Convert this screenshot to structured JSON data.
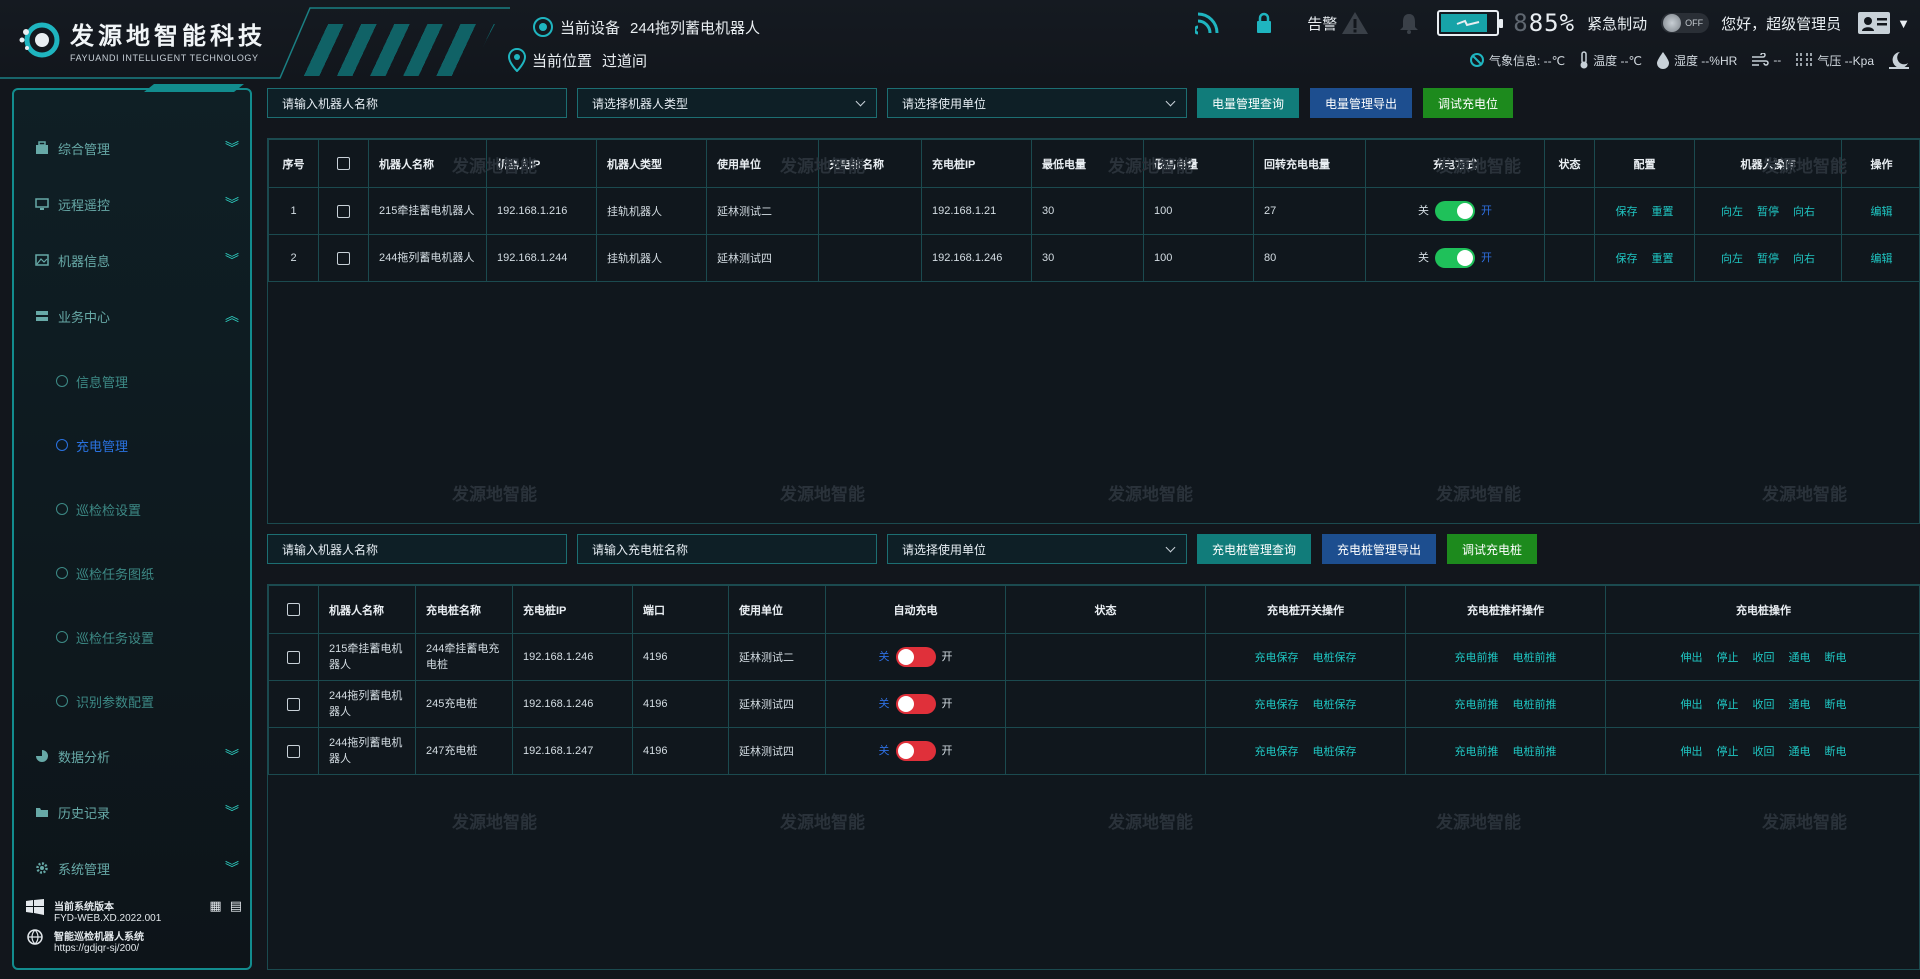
{
  "header": {
    "logo_cn": "发源地智能科技",
    "logo_en": "FAYUANDI INTELLIGENT TECHNOLOGY",
    "current_device_label": "当前设备",
    "current_device_value": "244拖列蓄电机器人",
    "current_position_label": "当前位置",
    "current_position_value": "过道间",
    "alarm_label": "告警",
    "battery_percent_digits": "85",
    "battery_percent_dim": "8",
    "percent_sign": "%",
    "battery_level": 0.85,
    "emergency_label": "紧急制动",
    "toggle_label": "OFF",
    "greeting": "您好，",
    "user_role": "超级管理员",
    "weather": {
      "weather_label": "气象信息: --℃",
      "temp_label": "温度 --℃",
      "humidity_label": "湿度 --%HR",
      "wind_label": "--",
      "pressure_label": "气压 --Kpa"
    }
  },
  "sidebar": {
    "items": [
      {
        "label": "综合管理",
        "expanded": false
      },
      {
        "label": "远程遥控",
        "expanded": false
      },
      {
        "label": "机器信息",
        "expanded": false
      },
      {
        "label": "业务中心",
        "expanded": true
      },
      {
        "label": "数据分析",
        "expanded": false
      },
      {
        "label": "历史记录",
        "expanded": false
      },
      {
        "label": "系统管理",
        "expanded": false
      }
    ],
    "sub_items": [
      {
        "label": "信息管理"
      },
      {
        "label": "充电管理"
      },
      {
        "label": "巡检检设置"
      },
      {
        "label": "巡检任务图纸"
      },
      {
        "label": "巡检任务设置"
      },
      {
        "label": "识别参数配置"
      }
    ],
    "version_label": "当前系统版本",
    "version_value": "FYD-WEB.XD.2022.001",
    "system_name": "智能巡检机器人系统",
    "system_url": "https://gdjqr-sj/200/"
  },
  "filters_top": {
    "robot_name_placeholder": "请输入机器人名称",
    "robot_type_placeholder": "请选择机器人类型",
    "unit_placeholder": "请选择使用单位",
    "query_btn": "电量管理查询",
    "export_btn": "电量管理导出",
    "debug_btn": "调试充电位"
  },
  "table_top": {
    "headers": [
      "序号",
      "",
      "机器人名称",
      "机器人IP",
      "机器人类型",
      "使用单位",
      "充电桩名称",
      "充电桩IP",
      "最低电量",
      "最高电量",
      "回转充电电量",
      "充电方式",
      "状态",
      "配置",
      "机器人操作",
      "操作"
    ],
    "rows": [
      {
        "index": "1",
        "name": "215牵挂蓄电机器人",
        "ip": "192.168.1.216",
        "type": "挂轨机器人",
        "unit": "延林测试二",
        "pile_name": "",
        "pile_ip": "192.168.1.21",
        "min": "30",
        "max": "100",
        "return": "27",
        "off": "关",
        "on": "开",
        "save": "保存",
        "reset": "重置",
        "left": "向左",
        "stop": "暂停",
        "right": "向右",
        "edit": "编辑"
      },
      {
        "index": "2",
        "name": "244拖列蓄电机器人",
        "ip": "192.168.1.244",
        "type": "挂轨机器人",
        "unit": "延林测试四",
        "pile_name": "",
        "pile_ip": "192.168.1.246",
        "min": "30",
        "max": "100",
        "return": "80",
        "off": "关",
        "on": "开",
        "save": "保存",
        "reset": "重置",
        "left": "向左",
        "stop": "暂停",
        "right": "向右",
        "edit": "编辑"
      }
    ]
  },
  "filters_bottom": {
    "robot_name_placeholder": "请输入机器人名称",
    "pile_name_placeholder": "请输入充电桩名称",
    "unit_placeholder": "请选择使用单位",
    "query_btn": "充电桩管理查询",
    "export_btn": "充电桩管理导出",
    "debug_btn": "调试充电桩"
  },
  "table_bottom": {
    "headers": [
      "",
      "机器人名称",
      "充电桩名称",
      "充电桩IP",
      "端口",
      "使用单位",
      "自动充电",
      "状态",
      "充电桩开关操作",
      "充电桩推杆操作",
      "充电桩操作"
    ],
    "rows": [
      {
        "name": "215牵挂蓄电机器人",
        "pile": "244牵挂蓄电充电桩",
        "ip": "192.168.1.246",
        "port": "4196",
        "unit": "延林测试二",
        "off": "关",
        "on": "开",
        "status": "",
        "a1": "充电保存",
        "a2": "电桩保存",
        "b1": "充电前推",
        "b2": "电桩前推",
        "c1": "伸出",
        "c2": "停止",
        "c3": "收回",
        "c4": "通电",
        "c5": "断电"
      },
      {
        "name": "244拖列蓄电机器人",
        "pile": "245充电桩",
        "ip": "192.168.1.246",
        "port": "4196",
        "unit": "延林测试四",
        "off": "关",
        "on": "开",
        "status": "",
        "a1": "充电保存",
        "a2": "电桩保存",
        "b1": "充电前推",
        "b2": "电桩前推",
        "c1": "伸出",
        "c2": "停止",
        "c3": "收回",
        "c4": "通电",
        "c5": "断电"
      },
      {
        "name": "244拖列蓄电机器人",
        "pile": "247充电桩",
        "ip": "192.168.1.247",
        "port": "4196",
        "unit": "延林测试四",
        "off": "关",
        "on": "开",
        "status": "",
        "a1": "充电保存",
        "a2": "电桩保存",
        "b1": "充电前推",
        "b2": "电桩前推",
        "c1": "伸出",
        "c2": "停止",
        "c3": "收回",
        "c4": "通电",
        "c5": "断电"
      }
    ]
  },
  "watermark": "发源地智能",
  "colors": {
    "accent": "#128c8e",
    "link": "#1fc6c2",
    "switch_on": "#1fc15a",
    "switch_off": "#e0303a"
  }
}
